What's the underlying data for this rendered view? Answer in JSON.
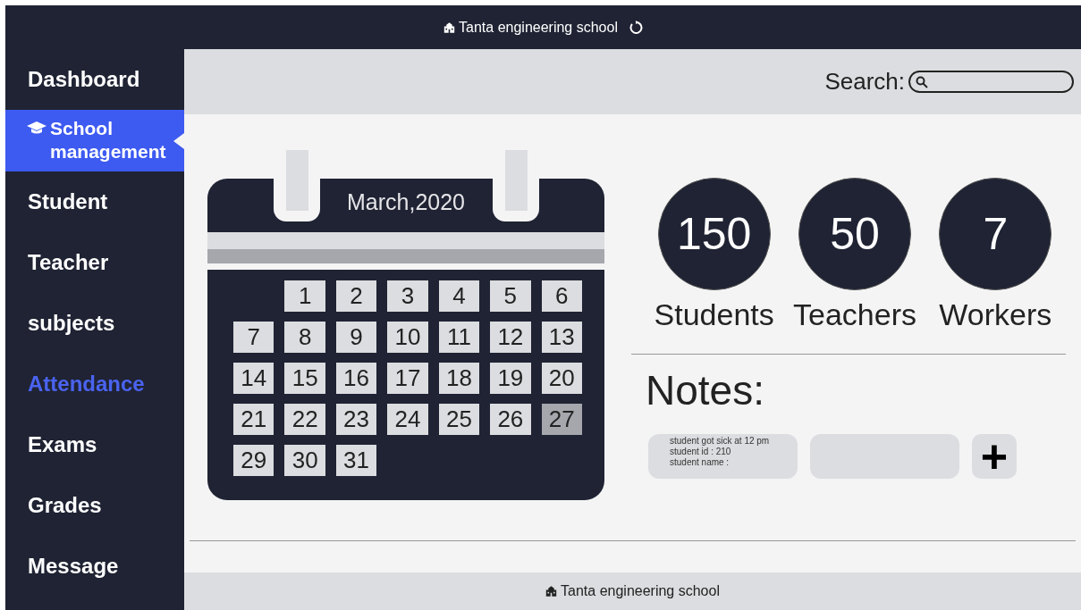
{
  "header": {
    "title": "Tanta engineering school"
  },
  "sidebar": {
    "items": [
      {
        "label": "Dashboard",
        "selected": false,
        "color": "#ffffff"
      },
      {
        "label": "School management",
        "selected": true,
        "color": "#ffffff"
      },
      {
        "label": "Student",
        "selected": false,
        "color": "#ffffff"
      },
      {
        "label": "Teacher",
        "selected": false,
        "color": "#ffffff"
      },
      {
        "label": "subjects",
        "selected": false,
        "color": "#ffffff"
      },
      {
        "label": "Attendance",
        "selected": false,
        "color": "#4a63f0"
      },
      {
        "label": "Exams",
        "selected": false,
        "color": "#ffffff"
      },
      {
        "label": "Grades",
        "selected": false,
        "color": "#ffffff"
      },
      {
        "label": "Message",
        "selected": false,
        "color": "#ffffff"
      }
    ]
  },
  "search": {
    "label": "Search:"
  },
  "calendar": {
    "title": "March,2020",
    "weeks": [
      [
        {
          "kind": "blank"
        },
        {
          "day": "1",
          "selected": false
        },
        {
          "day": "2",
          "selected": false
        },
        {
          "day": "3",
          "selected": false
        },
        {
          "day": "4",
          "selected": false
        },
        {
          "day": "5",
          "selected": false
        },
        {
          "day": "6",
          "selected": false
        }
      ],
      [
        {
          "day": "7",
          "selected": false
        },
        {
          "day": "8",
          "selected": false
        },
        {
          "day": "9",
          "selected": false
        },
        {
          "day": "10",
          "selected": false
        },
        {
          "day": "11",
          "selected": false
        },
        {
          "day": "12",
          "selected": false
        },
        {
          "day": "13",
          "selected": false
        }
      ],
      [
        {
          "day": "14",
          "selected": false
        },
        {
          "day": "15",
          "selected": false
        },
        {
          "day": "16",
          "selected": false
        },
        {
          "day": "17",
          "selected": false
        },
        {
          "day": "18",
          "selected": false
        },
        {
          "day": "19",
          "selected": false
        },
        {
          "day": "20",
          "selected": false
        }
      ],
      [
        {
          "day": "21",
          "selected": false
        },
        {
          "day": "22",
          "selected": false
        },
        {
          "day": "23",
          "selected": false
        },
        {
          "day": "24",
          "selected": false
        },
        {
          "day": "25",
          "selected": false
        },
        {
          "day": "26",
          "selected": false
        },
        {
          "day": "27",
          "selected": true
        }
      ],
      [
        {
          "day": "29",
          "selected": false
        },
        {
          "day": "30",
          "selected": false
        },
        {
          "day": "31",
          "selected": false
        },
        {
          "kind": "blank"
        },
        {
          "kind": "blank"
        },
        {
          "kind": "blank"
        },
        {
          "kind": "blank"
        }
      ]
    ]
  },
  "stats": [
    {
      "value": "150",
      "label": "Students"
    },
    {
      "value": "50",
      "label": "Teachers"
    },
    {
      "value": "7",
      "label": "Workers"
    }
  ],
  "notes": {
    "title": "Notes:",
    "cards": [
      {
        "kind": "text",
        "lines": [
          "student got sick at 12 pm",
          "student id : 210",
          "student name :"
        ]
      },
      {
        "kind": "empty"
      }
    ],
    "add_button": "+"
  },
  "footer": {
    "title": "Tanta engineering school"
  }
}
